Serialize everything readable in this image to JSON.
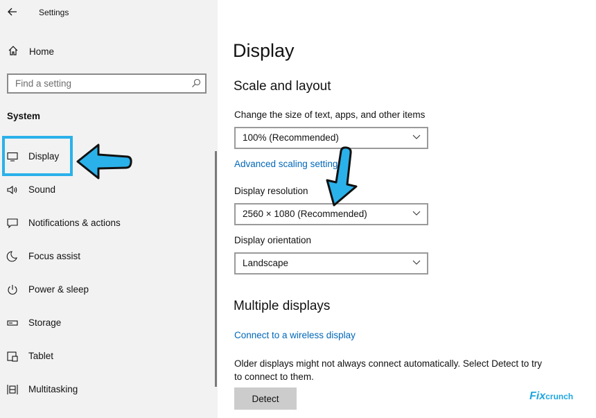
{
  "window": {
    "title": "Settings"
  },
  "sidebar": {
    "home_label": "Home",
    "search_placeholder": "Find a setting",
    "section_label": "System",
    "items": [
      {
        "label": "Display",
        "icon": "monitor-icon",
        "selected": true
      },
      {
        "label": "Sound",
        "icon": "speaker-icon"
      },
      {
        "label": "Notifications & actions",
        "icon": "notification-icon"
      },
      {
        "label": "Focus assist",
        "icon": "moon-icon"
      },
      {
        "label": "Power & sleep",
        "icon": "power-icon"
      },
      {
        "label": "Storage",
        "icon": "storage-icon"
      },
      {
        "label": "Tablet",
        "icon": "tablet-icon"
      },
      {
        "label": "Multitasking",
        "icon": "multitasking-icon"
      }
    ]
  },
  "main": {
    "page_title": "Display",
    "scale_section": {
      "title": "Scale and layout",
      "scale_label": "Change the size of text, apps, and other items",
      "scale_value": "100% (Recommended)",
      "advanced_link": "Advanced scaling settings",
      "resolution_label": "Display resolution",
      "resolution_value": "2560 × 1080 (Recommended)",
      "orientation_label": "Display orientation",
      "orientation_value": "Landscape"
    },
    "multiple_section": {
      "title": "Multiple displays",
      "wireless_link": "Connect to a wireless display",
      "description": "Older displays might not always connect automatically. Select Detect to try to connect to them.",
      "detect_label": "Detect"
    }
  },
  "watermark": {
    "main": "Fix",
    "small": "crunch"
  },
  "colors": {
    "sidebar_bg": "#f2f2f2",
    "accent_link": "#0067b8",
    "annotation": "#2ab1ea",
    "button_bg": "#cccccc"
  }
}
